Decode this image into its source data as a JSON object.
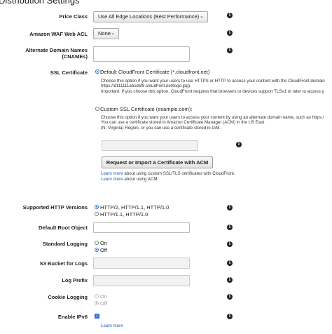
{
  "section_title": "Distribution Settings",
  "price_class": {
    "label": "Price Class",
    "value": "Use All Edge Locations (Best Performance)"
  },
  "waf": {
    "label": "Amazon WAF Web ACL",
    "value": "None"
  },
  "cnames": {
    "label_line1": "Alternate Domain Names",
    "label_line2": "(CNAMEs)",
    "value": ""
  },
  "ssl": {
    "label": "SSL Certificate",
    "default_option": "Default CloudFront Certificate (*.cloudfront.net)",
    "default_desc_1": "Choose this option if you want your users to use HTTPS or HTTP to access your content with the CloudFront domain",
    "default_desc_2": "https://d111111abcdef8.cloudfront.net/logo.jpg).",
    "default_desc_3": "Important: If you choose this option, CloudFront requires that browsers or devices support TLSv1 or later to access y",
    "custom_option": "Custom SSL Certificate (example.com):",
    "custom_desc_1": "Choose this option if you want your users to access your content by using an alternate domain name, such as https:/",
    "custom_desc_2": "You can use a certificate stored in Amazon Certificate Manager (ACM) in the US East",
    "custom_desc_3": "(N. Virginia) Region, or you can use a certificate stored in IAM.",
    "certificate_value": "",
    "acm_button": "Request or Import a Certificate with ACM",
    "learn_more_link": "Learn more",
    "learn_more_tail_1": " about using custom SSL/TLS certificates with CloudFront.",
    "learn_more_tail_2": " about using ACM."
  },
  "http_versions": {
    "label": "Supported HTTP Versions",
    "option1": "HTTP/2, HTTP/1.1, HTTP/1.0",
    "option2": "HTTP/1.1, HTTP/1.0",
    "selected": "HTTP/2, HTTP/1.1, HTTP/1.0"
  },
  "default_root": {
    "label": "Default Root Object",
    "value": ""
  },
  "logging": {
    "label": "Standard Logging",
    "on": "On",
    "off": "Off",
    "selected": "Off"
  },
  "s3_bucket": {
    "label": "S3 Bucket for Logs",
    "value": ""
  },
  "log_prefix": {
    "label": "Log Prefix",
    "value": ""
  },
  "cookie_logging": {
    "label": "Cookie Logging",
    "on": "On",
    "off": "Off",
    "selected": "Off"
  },
  "ipv6": {
    "label": "Enable IPv6",
    "checked": true,
    "learn_more": "Learn more"
  },
  "colors": {
    "link": "#1f5db5",
    "accent": "#2a6fd6"
  },
  "icons": {
    "info": "info-icon",
    "dropdown": "chevron-down-icon"
  }
}
